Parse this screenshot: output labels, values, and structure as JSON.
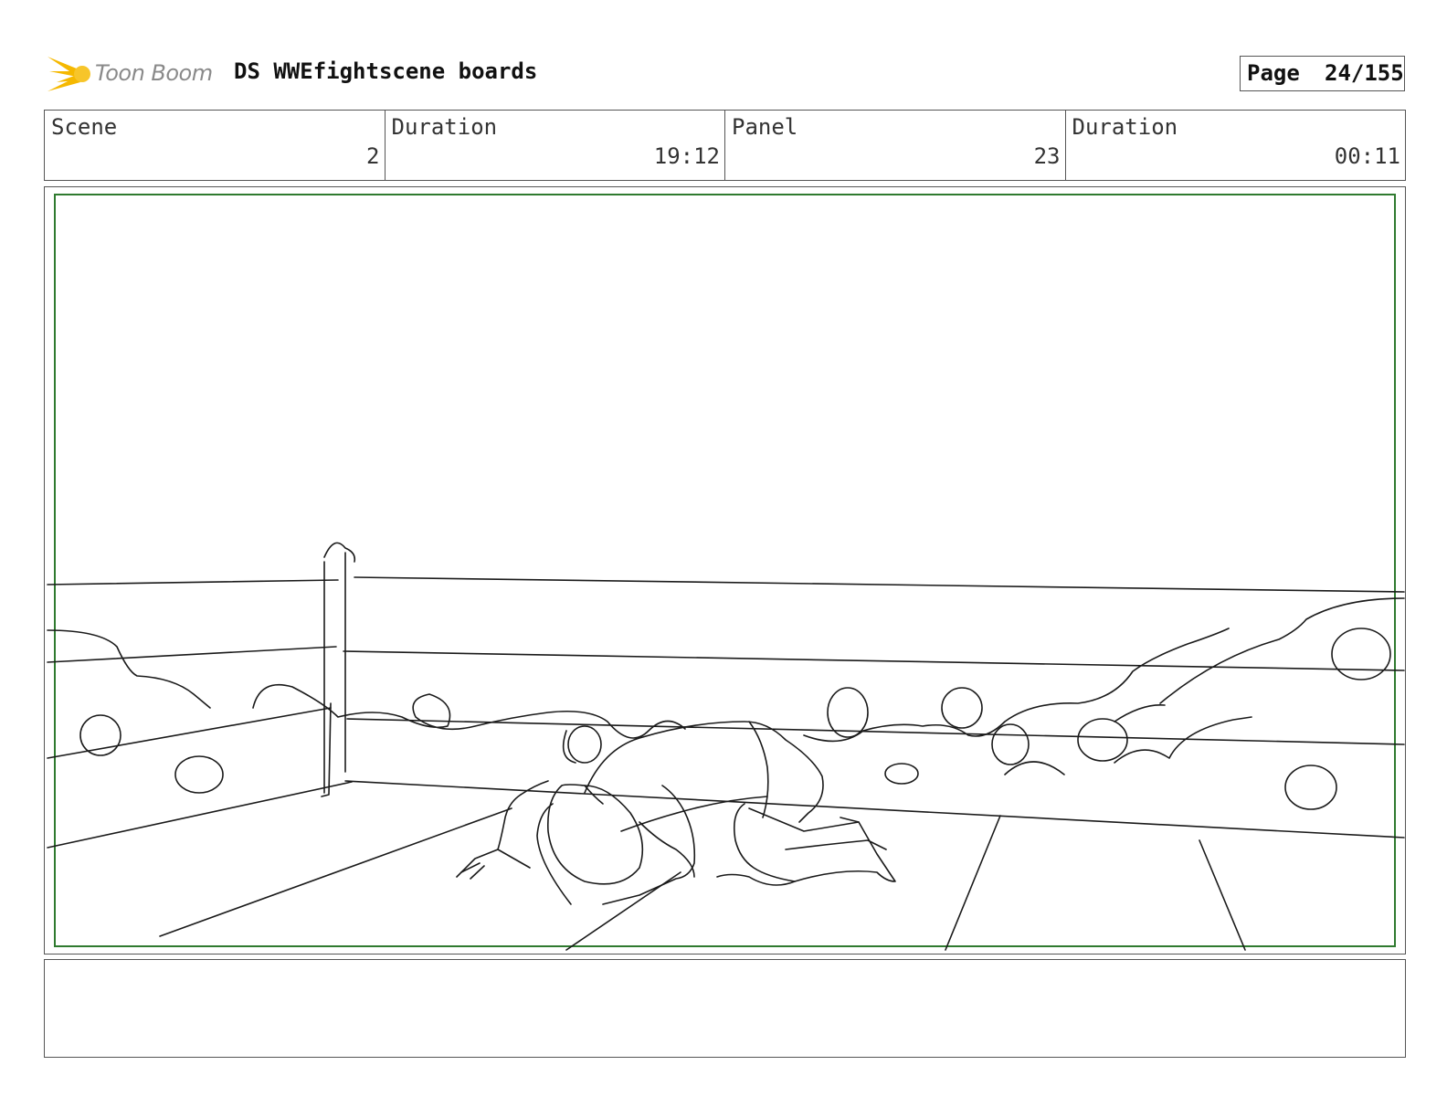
{
  "header": {
    "logo_text": "Toon Boom",
    "title": "DS WWEfightscene boards",
    "page_label": "Page",
    "page_value": "24/155"
  },
  "info": {
    "scene_label": "Scene",
    "scene_value": "2",
    "scene_duration_label": "Duration",
    "scene_duration_value": "19:12",
    "panel_label": "Panel",
    "panel_value": "23",
    "panel_duration_label": "Duration",
    "panel_duration_value": "00:11"
  },
  "panel": {
    "safe_area_color": "#2f7a2f",
    "sketch_subject": "wrestler on hands and knees in ring"
  },
  "notes": {
    "text": ""
  },
  "colors": {
    "logo_accent": "#f5b800",
    "border": "#555555"
  }
}
